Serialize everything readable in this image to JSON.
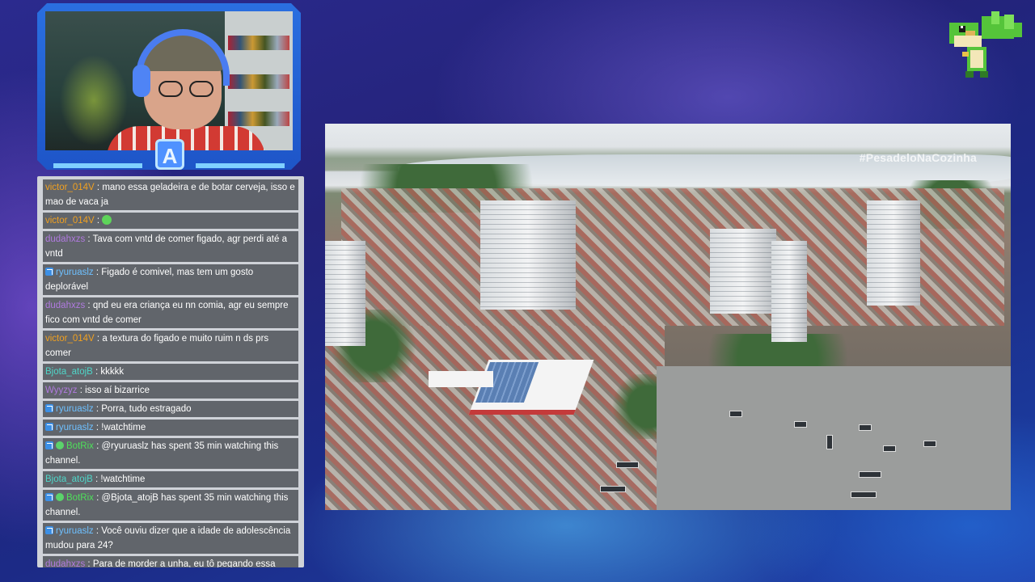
{
  "overlay": {
    "logo_letter": "A"
  },
  "video": {
    "watermark": "#PesadeloNaCozinha"
  },
  "colors": {
    "username_orange": "#f0a020",
    "username_purple": "#b07adf",
    "username_blue": "#6ec0ff",
    "username_teal": "#4fd6c8",
    "username_green": "#4ee05a"
  },
  "chat": {
    "messages": [
      {
        "user": "victor_014V",
        "color": "#f0a020",
        "text": "mano essa geladeira e de botar cerveja, isso e mao de vaca ja"
      },
      {
        "user": "victor_014V",
        "color": "#f0a020",
        "text": "",
        "emote": "green-face-emote"
      },
      {
        "user": "dudahxzs",
        "color": "#b07adf",
        "text": "Tava com vntd de comer figado, agr perdi até a vntd"
      },
      {
        "user": "ryuruaslz",
        "color": "#6ec0ff",
        "badge": "badge-icon",
        "text": "Figado é comivel, mas tem um gosto deplorável"
      },
      {
        "user": "dudahxzs",
        "color": "#b07adf",
        "text": "qnd eu era criança eu nn comia, agr eu sempre fico com vntd de comer"
      },
      {
        "user": "victor_014V",
        "color": "#f0a020",
        "text": "a textura do figado e muito ruim n ds prs comer"
      },
      {
        "user": "Bjota_atojB",
        "color": "#4fd6c8",
        "text": "kkkkk"
      },
      {
        "user": "Wyyzyz",
        "color": "#b07adf",
        "text": "isso aí bizarrice"
      },
      {
        "user": "ryuruaslz",
        "color": "#6ec0ff",
        "badge": "badge-icon",
        "text": "Porra, tudo estragado"
      },
      {
        "user": "ryuruaslz",
        "color": "#6ec0ff",
        "badge": "badge-icon",
        "text": "!watchtime"
      },
      {
        "user": "BotRix",
        "color": "#4ee05a",
        "badge": "badge-icon",
        "check": true,
        "text": "@ryuruaslz has spent 35 min watching this channel."
      },
      {
        "user": "Bjota_atojB",
        "color": "#4fd6c8",
        "text": "!watchtime"
      },
      {
        "user": "BotRix",
        "color": "#4ee05a",
        "badge": "badge-icon",
        "check": true,
        "text": "@Bjota_atojB has spent 35 min watching this channel."
      },
      {
        "user": "ryuruaslz",
        "color": "#6ec0ff",
        "badge": "badge-icon",
        "text": "Você ouviu dizer que a idade de adolescência mudou para 24?"
      },
      {
        "user": "dudahxzs",
        "color": "#b07adf",
        "text": "Para de morder a unha, eu tô pegando essa mania tbm",
        "emote_end": "blush-face-emote"
      }
    ]
  }
}
